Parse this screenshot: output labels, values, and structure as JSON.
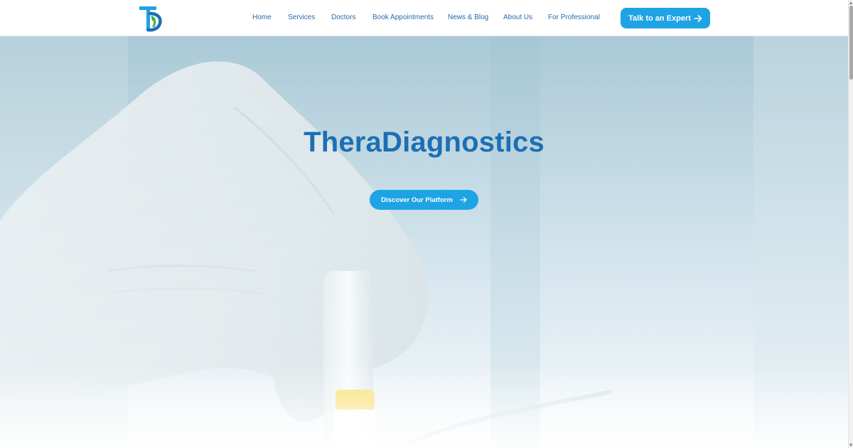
{
  "brand": {
    "logo_icon": "theradiagnostics-logo",
    "primary_color": "#1d6fb5",
    "accent_color": "#1ea3e4"
  },
  "nav": {
    "items": [
      {
        "label": "Home"
      },
      {
        "label": "Services"
      },
      {
        "label": "Doctors"
      },
      {
        "label": "Book Appointments"
      },
      {
        "label": "News & Blog"
      },
      {
        "label": "About Us"
      },
      {
        "label": "For Professional"
      }
    ],
    "cta_label": "Talk to an Expert"
  },
  "hero": {
    "title": "TheraDiagnostics",
    "button_label": "Discover Our Platform"
  }
}
